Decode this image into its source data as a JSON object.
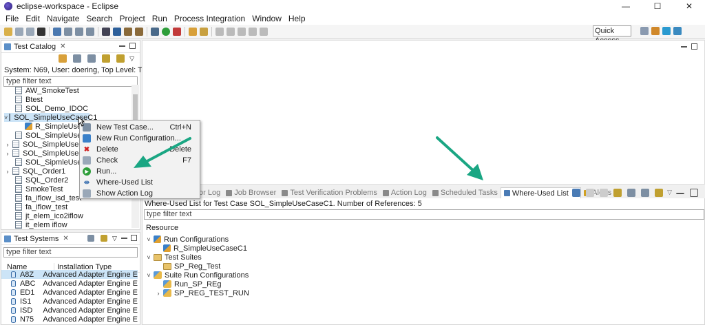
{
  "window": {
    "title": "eclipse-workspace - Eclipse"
  },
  "menu": [
    "File",
    "Edit",
    "Navigate",
    "Search",
    "Project",
    "Run",
    "Process Integration",
    "Window",
    "Help"
  ],
  "toolbar": {
    "quick_access": "Quick Access"
  },
  "test_catalog": {
    "tab_label": "Test Catalog",
    "info": "System: N69, User: doering, Top Level: Test Case",
    "filter_placeholder": "type filter text",
    "items": [
      {
        "label": "AW_SmokeTest"
      },
      {
        "label": "Btest"
      },
      {
        "label": "SOL_Demo_IDOC"
      },
      {
        "label": "SOL_SimpleUseCaseC1"
      },
      {
        "label": "R_SimpleUseCase"
      },
      {
        "label": "SOL_SimpleUseCase"
      },
      {
        "label": "SOL_SimpleUseCase"
      },
      {
        "label": "SOL_SimpleUsecase"
      },
      {
        "label": "SOL_SipmleUseCase"
      },
      {
        "label": "SQL_Order1"
      },
      {
        "label": "SQL_Order2"
      },
      {
        "label": "SmokeTest"
      },
      {
        "label": "fa_iflow_isd_test"
      },
      {
        "label": "fa_iflow_test"
      },
      {
        "label": "jt_elem_ico2iflow"
      },
      {
        "label": "it_elem iflow"
      }
    ]
  },
  "context_menu": {
    "items": [
      {
        "label": "New Test Case...",
        "shortcut": "Ctrl+N"
      },
      {
        "label": "New Run Configuration...",
        "shortcut": ""
      },
      {
        "label": "Delete",
        "shortcut": "Delete"
      },
      {
        "label": "Check",
        "shortcut": "F7"
      },
      {
        "label": "Run...",
        "shortcut": ""
      },
      {
        "label": "Where-Used List",
        "shortcut": ""
      },
      {
        "label": "Show Action Log",
        "shortcut": ""
      }
    ]
  },
  "test_systems": {
    "tab_label": "Test Systems",
    "filter_placeholder": "type filter text",
    "columns": [
      "Name",
      "Installation Type"
    ],
    "rows": [
      {
        "name": "A8Z",
        "type": "Advanced Adapter Engine E"
      },
      {
        "name": "ABC",
        "type": "Advanced Adapter Engine E"
      },
      {
        "name": "ED1",
        "type": "Advanced Adapter Engine E"
      },
      {
        "name": "IS1",
        "type": "Advanced Adapter Engine E"
      },
      {
        "name": "ISD",
        "type": "Advanced Adapter Engine E"
      },
      {
        "name": "N75",
        "type": "Advanced Adapter Engine E"
      }
    ]
  },
  "bottom_tabs": [
    "or Log",
    "Job Browser",
    "Test Verification Problems",
    "Action Log",
    "Scheduled Tasks",
    "Where-Used List",
    "Alerts"
  ],
  "where_used": {
    "header": "Where-Used List for Test Case SOL_SimpleUseCaseC1. Number of References: 5",
    "filter_placeholder": "type filter text",
    "column": "Resource",
    "groups": [
      {
        "label": "Run Configurations",
        "children": [
          "R_SimpleUseCaseC1"
        ]
      },
      {
        "label": "Test Suites",
        "children": [
          "SP_Reg_Test"
        ]
      },
      {
        "label": "Suite Run Configurations",
        "children": [
          "Run_SP_REg",
          "SP_REG_TEST_RUN"
        ]
      }
    ]
  },
  "colors": {
    "arrow": "#1aa683",
    "selection": "#cce4f7"
  }
}
